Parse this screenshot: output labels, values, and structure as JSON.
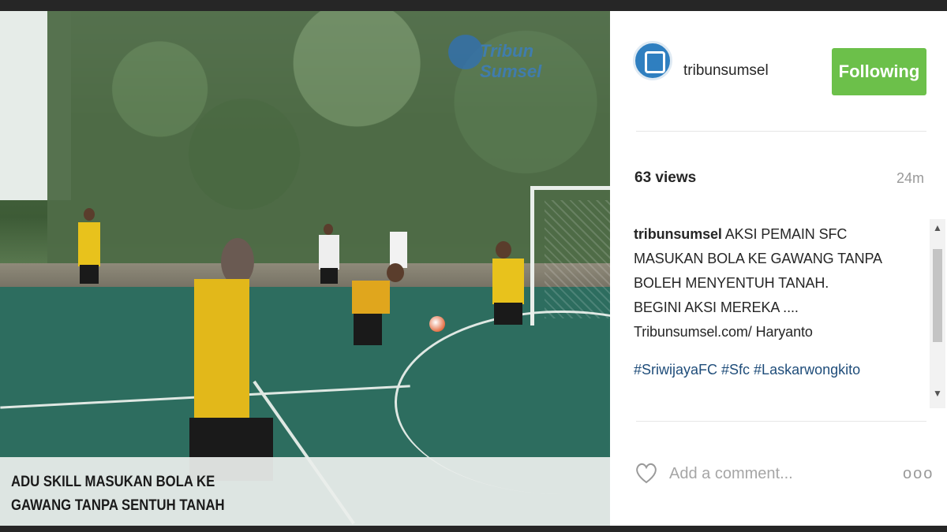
{
  "video": {
    "caption": "ADU SKILL MASUKAN BOLA KE\nGAWANG TANPA SENTUH TANAH"
  },
  "post": {
    "username": "tribunsumsel",
    "follow_label": "Following",
    "views": "63 views",
    "time_ago": "24m",
    "comment_user": "tribunsumsel",
    "comment_lines": [
      "AKSI PEMAIN SFC",
      "MASUKAN BOLA KE GAWANG TANPA",
      "BOLEH MENYENTUH TANAH.",
      "BEGINI AKSI MEREKA ....",
      "Tribunsumsel.com/ Haryanto"
    ],
    "hashtags": "#SriwijayaFC #Sfc #Laskarwongkito",
    "comment_placeholder": "Add a comment...",
    "more_label": "ooo"
  },
  "colors": {
    "follow_button": "#6cc04a",
    "hashtag": "#1f4d7a",
    "avatar": "#2f7fc0"
  },
  "icons": {
    "like": "heart-icon",
    "more": "more-options-icon",
    "scroll_up": "chevron-up-icon",
    "scroll_down": "chevron-down-icon"
  }
}
